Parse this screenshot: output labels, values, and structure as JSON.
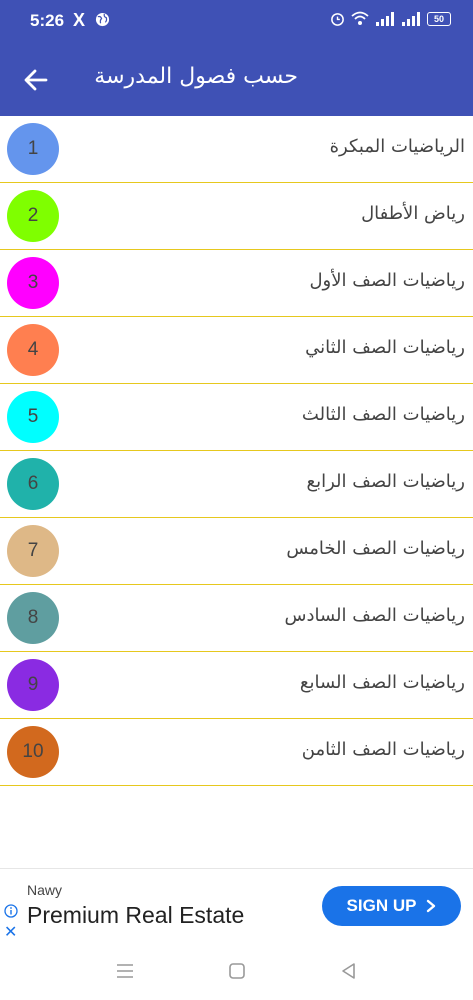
{
  "status_bar": {
    "time": "5:26",
    "x_logo": "X",
    "battery": "50",
    "icons": [
      "globe-icon",
      "alarm-icon",
      "wifi-icon",
      "signal-icon",
      "signal-icon",
      "battery-icon"
    ]
  },
  "app_bar": {
    "title": "حسب فصول المدرسة",
    "back_icon": "arrow-left-icon",
    "color": "#3f51b5"
  },
  "list": {
    "divider_color": "#e6c81e",
    "items": [
      {
        "number": "1",
        "label": "الرياضيات المبكرة",
        "color": "#6495ed"
      },
      {
        "number": "2",
        "label": "رياض الأطفال",
        "color": "#7fff00"
      },
      {
        "number": "3",
        "label": "رياضيات الصف الأول",
        "color": "#ff00ff"
      },
      {
        "number": "4",
        "label": "رياضيات الصف الثاني",
        "color": "#ff7f50"
      },
      {
        "number": "5",
        "label": "رياضيات الصف الثالث",
        "color": "#00ffff"
      },
      {
        "number": "6",
        "label": "رياضيات الصف الرابع",
        "color": "#20b2aa"
      },
      {
        "number": "7",
        "label": "رياضيات الصف الخامس",
        "color": "#deb887"
      },
      {
        "number": "8",
        "label": "رياضيات الصف السادس",
        "color": "#5f9ea0"
      },
      {
        "number": "9",
        "label": "رياضيات الصف السابع",
        "color": "#8a2be2"
      },
      {
        "number": "10",
        "label": "رياضيات الصف الثامن",
        "color": "#d2691e"
      }
    ]
  },
  "ad": {
    "advertiser": "Nawy",
    "headline": "Premium Real Estate",
    "cta_label": "SIGN UP",
    "cta_icon": "chevron-right-icon",
    "info_icon": "info-icon",
    "close_label": "✕"
  },
  "nav_bar": {
    "buttons": [
      "menu-icon",
      "home-square-icon",
      "back-triangle-icon"
    ]
  }
}
